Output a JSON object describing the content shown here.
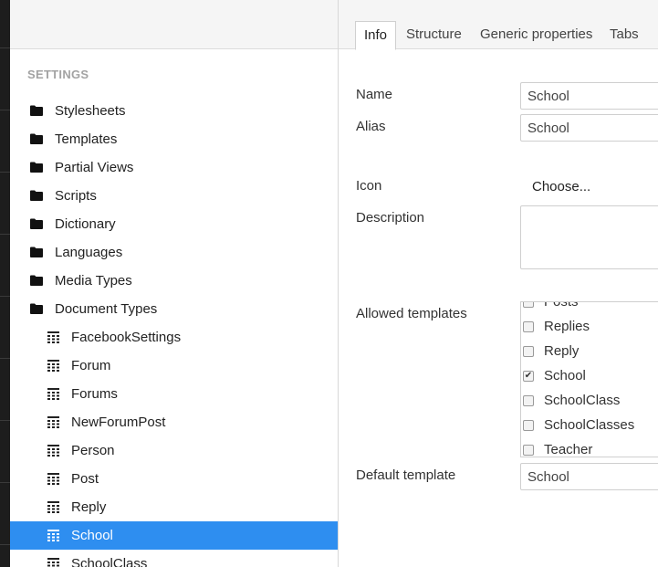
{
  "tree": {
    "section_title": "SETTINGS",
    "folders": [
      {
        "label": "Stylesheets"
      },
      {
        "label": "Templates"
      },
      {
        "label": "Partial Views"
      },
      {
        "label": "Scripts"
      },
      {
        "label": "Dictionary"
      },
      {
        "label": "Languages"
      },
      {
        "label": "Media Types"
      },
      {
        "label": "Document Types"
      }
    ],
    "document_types": [
      {
        "label": "FacebookSettings"
      },
      {
        "label": "Forum"
      },
      {
        "label": "Forums"
      },
      {
        "label": "NewForumPost"
      },
      {
        "label": "Person"
      },
      {
        "label": "Post"
      },
      {
        "label": "Reply"
      },
      {
        "label": "School",
        "selected": true
      },
      {
        "label": "SchoolClass"
      }
    ]
  },
  "tabs": [
    {
      "label": "Info",
      "active": true
    },
    {
      "label": "Structure"
    },
    {
      "label": "Generic properties"
    },
    {
      "label": "Tabs"
    }
  ],
  "info": {
    "name_label": "Name",
    "name_value": "School",
    "alias_label": "Alias",
    "alias_value": "School",
    "icon_label": "Icon",
    "icon_choose": "Choose...",
    "description_label": "Description",
    "description_value": "",
    "allowed_templates_label": "Allowed templates",
    "templates": [
      {
        "label": "Posts",
        "checked": false
      },
      {
        "label": "Replies",
        "checked": false
      },
      {
        "label": "Reply",
        "checked": false
      },
      {
        "label": "School",
        "checked": true
      },
      {
        "label": "SchoolClass",
        "checked": false
      },
      {
        "label": "SchoolClasses",
        "checked": false
      },
      {
        "label": "Teacher",
        "checked": false
      }
    ],
    "default_template_label": "Default template",
    "default_template_value": "School"
  },
  "colors": {
    "selected_bg": "#2e8ef0",
    "left_bar": "#1d1d1d"
  }
}
